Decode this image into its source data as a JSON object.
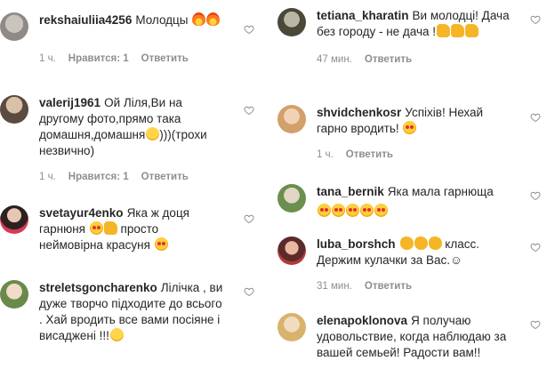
{
  "left": [
    {
      "username": "rekshaiuliia4256",
      "text": "Молодцы",
      "emoji": [
        "fire",
        "fire"
      ],
      "time": "1 ч.",
      "likes": "Нравится: 1",
      "reply": "Ответить"
    },
    {
      "username": "valerij1961",
      "text": "Ой Ліля,Ви на другому фото,прямо така домашня,домашня",
      "after": ")))(трохи незвично)",
      "time": "1 ч.",
      "likes": "Нравится: 1",
      "reply": "Ответить"
    },
    {
      "username": "svetayur4enko",
      "text": "Яка ж доця гарнюня",
      "mid": "просто неймовірна красуня",
      "time": "",
      "likes": "",
      "reply": ""
    },
    {
      "username": "streletsgoncharenko",
      "text": "Лілічка , ви дуже творчо підходите до всього . Хай вродить все вами посіяне і висаджені !!!",
      "time": "",
      "likes": "",
      "reply": ""
    }
  ],
  "right": [
    {
      "username": "tetiana_kharatin",
      "text": "Ви молодці! Дача без городу - не дача !",
      "time": "47 мин.",
      "reply": "Ответить"
    },
    {
      "username": "shvidchenkosr",
      "text": "Успіхів! Нехай гарно вродить!",
      "time": "1 ч.",
      "reply": "Ответить"
    },
    {
      "username": "tana_bernik",
      "text": "Яка мала гарнюща",
      "time": "",
      "reply": ""
    },
    {
      "username": "luba_borshch",
      "text": "класс. Держим кулачки за Вас.☺",
      "time": "31 мин.",
      "reply": "Ответить"
    },
    {
      "username": "elenapoklonova",
      "text": "Я получаю удовольствие, когда наблюдаю за вашей семьей! Радости вам!!",
      "time": "",
      "reply": ""
    }
  ],
  "colors": {
    "text": "#262626",
    "meta": "#8e8e8e",
    "heart": "#8e8e8e"
  }
}
